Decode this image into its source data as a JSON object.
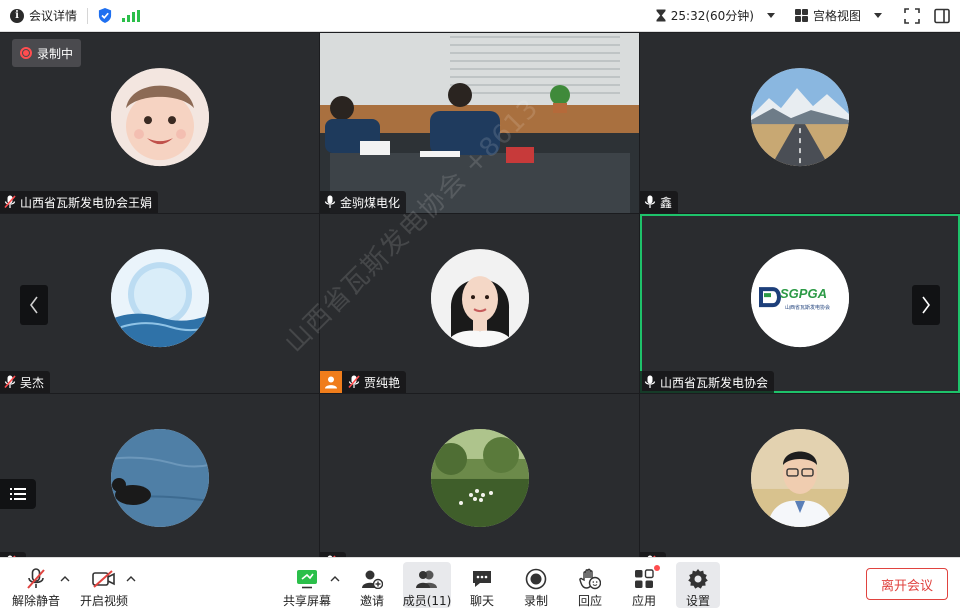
{
  "topbar": {
    "meeting_info": "会议详情",
    "timer": "25:32(60分钟)",
    "view_mode": "宫格视图"
  },
  "recording": {
    "label": "录制中"
  },
  "participants": [
    {
      "name": "山西省瓦斯发电协会王娟",
      "avatar": "baby-photo",
      "mic": "muted"
    },
    {
      "name": "金驹煤电化",
      "avatar": "live-video-meeting-room",
      "mic": "on"
    },
    {
      "name": "鑫",
      "avatar": "road-mountain-photo",
      "mic": "on"
    },
    {
      "name": "吴杰",
      "avatar": "water-droplet-photo",
      "mic": "muted"
    },
    {
      "name": "贾纯艳",
      "avatar": "woman-portrait-photo",
      "mic": "muted",
      "role_icon": "host-person-icon"
    },
    {
      "name": "山西省瓦斯发电协会",
      "avatar": "sgpga-logo",
      "mic": "on",
      "active_speaker": true
    },
    {
      "name": "",
      "avatar": "bird-on-water-photo",
      "mic": "muted"
    },
    {
      "name": "",
      "avatar": "flowers-photo",
      "mic": "muted"
    },
    {
      "name": "",
      "avatar": "man-glasses-portrait-photo",
      "mic": "muted"
    }
  ],
  "logo_text": {
    "abbr": "SGPGA",
    "full": "山西省瓦斯发电协会"
  },
  "watermark": "山西省瓦斯发电协会 +8613",
  "toolbar": {
    "unmute": "解除静音",
    "start_video": "开启视频",
    "share_screen": "共享屏幕",
    "invite": "邀请",
    "members": "成员(11)",
    "chat": "聊天",
    "record": "录制",
    "reactions": "回应",
    "apps": "应用",
    "settings": "设置",
    "leave": "离开会议"
  },
  "colors": {
    "active_border": "#1ec26a",
    "record_red": "#ff4d4f",
    "leave_red": "#e0433f",
    "signal_green": "#2bbf4a",
    "shield_blue": "#1e6ff0"
  }
}
